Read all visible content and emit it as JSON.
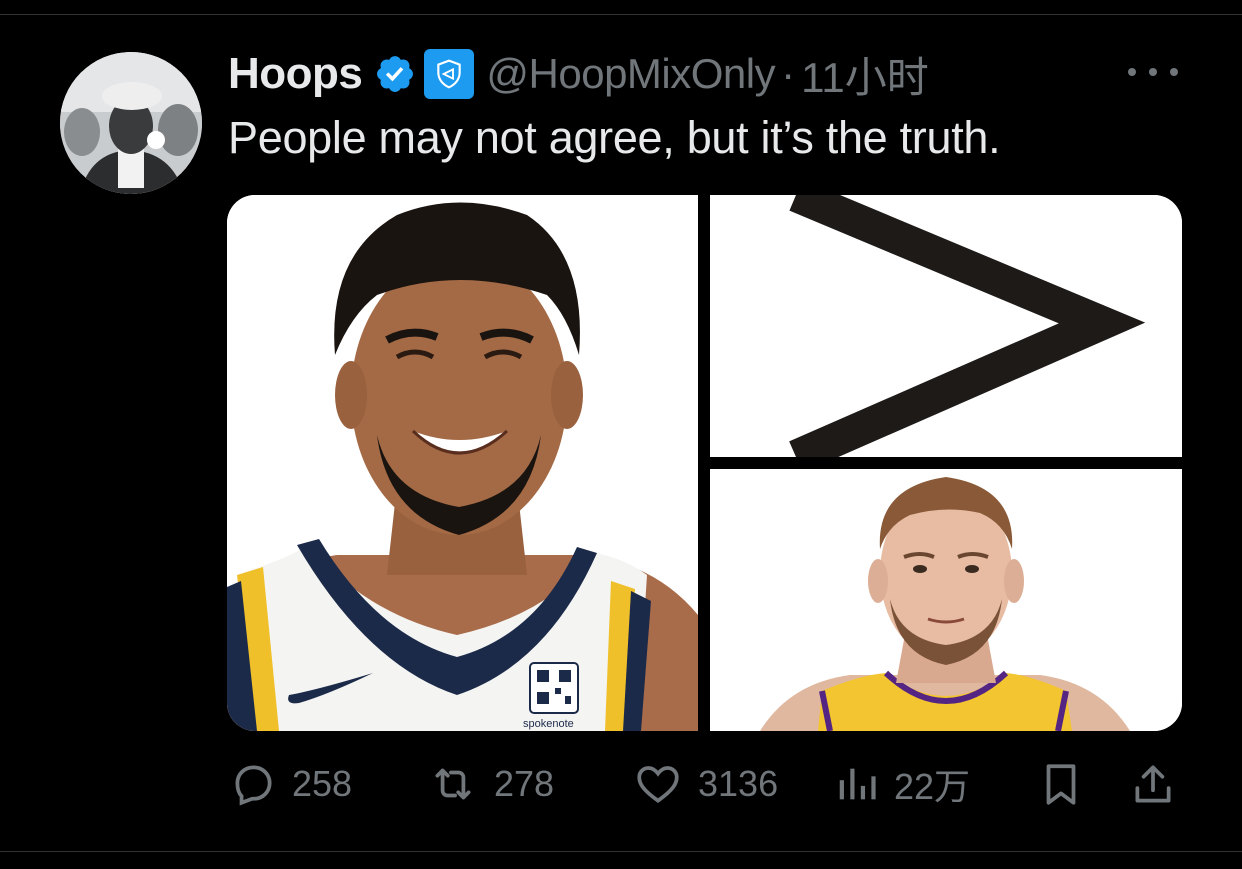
{
  "tweet": {
    "display_name": "Hoops",
    "handle": "@HoopMixOnly",
    "separator": "·",
    "time": "11小时",
    "text": "People may not agree, but it’s the truth."
  },
  "media": {
    "images": [
      {
        "subject": "smiling basketball player in white jersey with navy collar and yellow trim",
        "jersey_brand_text": "spokenote"
      },
      {
        "subject": "greater-than symbol"
      },
      {
        "subject": "basketball player in yellow jersey with purple trim"
      }
    ]
  },
  "actions": {
    "replies": "258",
    "retweets": "278",
    "likes": "3136",
    "views": "22万"
  },
  "colors": {
    "background": "#000000",
    "text_primary": "#e7e9ea",
    "text_secondary": "#71767b",
    "verified_blue": "#1d9bf0"
  },
  "icons": [
    "verified-badge-icon",
    "government-badge-icon",
    "more-options-icon",
    "reply-icon",
    "retweet-icon",
    "like-icon",
    "views-icon",
    "bookmark-icon",
    "share-icon"
  ]
}
